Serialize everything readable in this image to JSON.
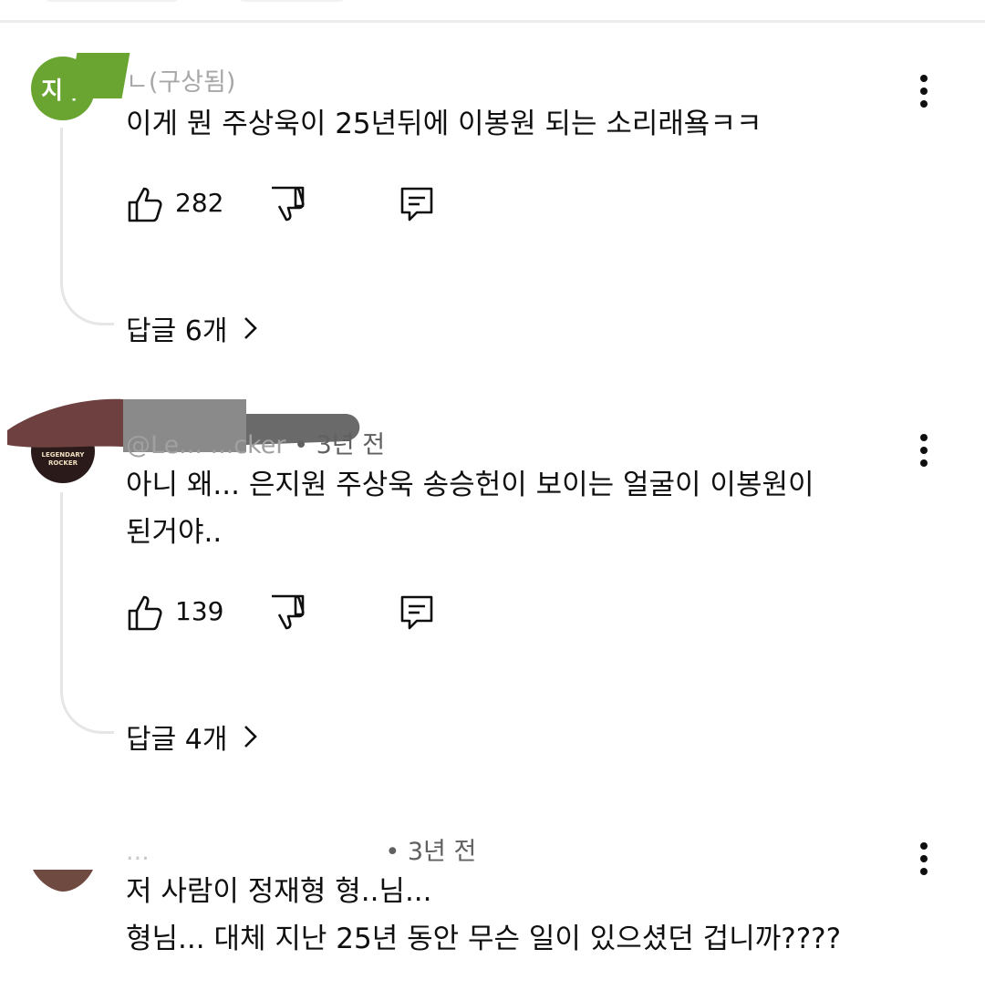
{
  "comments": [
    {
      "author_fragment": "ㄴ(구상됨)",
      "avatar_text": "지ㅣ",
      "avatar_color": "#6aa532",
      "time": "",
      "text_lines": [
        "이게 뭔 주상욱이 25년뒤에 이봉원 되는 소리래욬ㅋㅋ"
      ],
      "likes": "282",
      "replies_label": "답글 6개"
    },
    {
      "author_fragment": "@Le... ...cker",
      "meta_time": "• 3년 전",
      "avatar_text": "LEGENDARY ROCKER",
      "avatar_color": "#2a1a1a",
      "text_lines": [
        "아니 왜... 은지원 주상욱 송승헌이 보이는 얼굴이 이봉원이",
        "된거야.."
      ],
      "likes": "139",
      "replies_label": "답글 4개"
    },
    {
      "author_fragment": "...",
      "meta_time": "• 3년 전",
      "avatar_color": "#6e4a40",
      "text_lines": [
        "저 사람이 정재형 형..님...",
        "형님... 대체 지난 25년 동안 무슨 일이 있으셨던 겁니까????"
      ]
    }
  ],
  "icons": {
    "like": "thumbs-up-icon",
    "dislike": "thumbs-down-icon",
    "reply": "comment-reply-icon",
    "more": "more-vertical-icon",
    "chevron": "chevron-right-icon"
  }
}
